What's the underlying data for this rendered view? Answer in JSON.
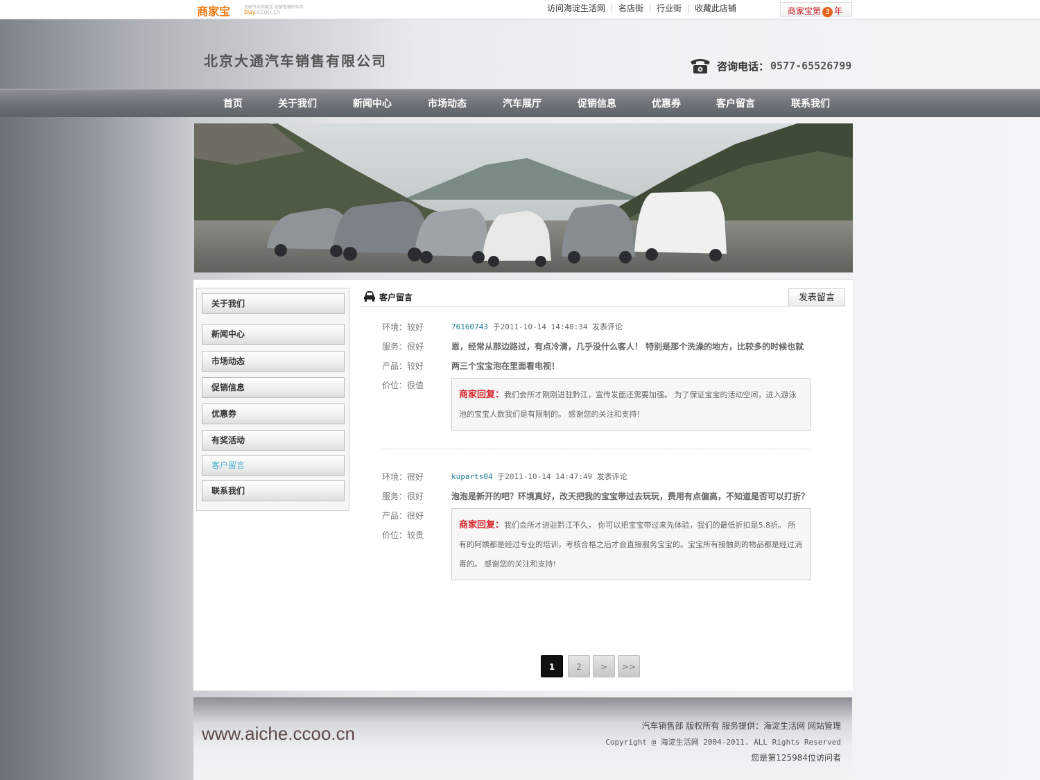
{
  "topbar": {
    "logo_brand": "商家宝",
    "logo_tagline": "全网专业商家宝  经营管理好伙伴",
    "logo_domain_main": "buy",
    "logo_domain_rest": ".ccoo.cn",
    "links": [
      "访问海淀生活网",
      "名店街",
      "行业街",
      "收藏此店铺"
    ],
    "badge_prefix": "商家宝第",
    "badge_num": "3",
    "badge_suffix": "年"
  },
  "header": {
    "company": "北京大通汽车销售有限公司",
    "hotline_label": "咨询电话：",
    "hotline_number": "0577-65526799"
  },
  "nav": [
    "首页",
    "关于我们",
    "新闻中心",
    "市场动态",
    "汽车展厅",
    "促销信息",
    "优惠券",
    "客户留言",
    "联系我们"
  ],
  "sidebar": [
    "关于我们",
    "新闻中心",
    "市场动态",
    "促销信息",
    "优惠券",
    "有奖活动",
    "客户留言",
    "联系我们"
  ],
  "section": {
    "title": "客户留言",
    "post_button": "发表留言"
  },
  "reviews": [
    {
      "ratings": [
        "环境：较好",
        "服务：很好",
        "产品：较好",
        "价位：很值"
      ],
      "user": "76160743",
      "meta_rest": " 于2011-10-14 14:48:34 发表评论",
      "comment": "恩，经常从那边路过，有点冷清，几乎没什么客人！ 特别是那个洗澡的地方，比较多的时候也就两三个宝宝泡在里面看电视！",
      "reply_label": "商家回复：",
      "reply": "我们会所才刚刚进驻黔江，宣传发面还需要加强。 为了保证宝宝的活动空间，进入游泳池的宝宝人数我们是有限制的。 感谢您的关注和支持!"
    },
    {
      "ratings": [
        "环境：很好",
        "服务：很好",
        "产品：很好",
        "价位：较贵"
      ],
      "user": "kuparts04",
      "meta_rest": " 于2011-10-14 14:47:49 发表评论",
      "comment": "泡泡是新开的吧？环境真好，改天把我的宝宝带过去玩玩，费用有点偏高，不知道是否可以打折？",
      "reply_label": "商家回复：",
      "reply": "我们会所才进驻黔江不久， 你可以把宝宝带过来先体验，我们的最低折扣是5.8折。 所有的阿姨都是经过专业的培训，考核合格之后才会直接服务宝宝的。宝宝所有接触到的物品都是经过消毒的。 感谢您的关注和支持!"
    }
  ],
  "pager": [
    "1",
    "2",
    ">",
    ">>"
  ],
  "footer": {
    "site": "www.aiche.ccoo.cn",
    "line1": "汽车销售部 版权所有 服务提供：海淀生活网 网站管理",
    "line2": "Copyright @ 海淀生活网 2004-2011. ALL Rights Reserved",
    "line3": "您是第125984位访问者"
  }
}
